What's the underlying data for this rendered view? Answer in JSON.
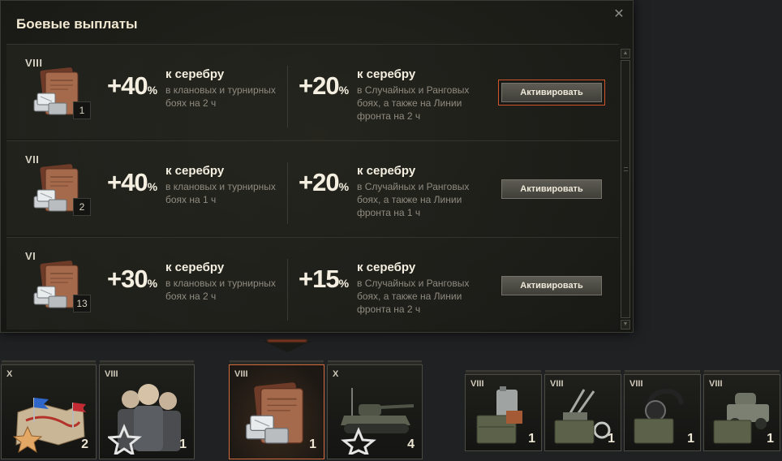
{
  "popup": {
    "title": "Боевые выплаты",
    "close_glyph": "✕",
    "rows": [
      {
        "tier": "VIII",
        "count": "1",
        "bonus1": {
          "value": "+40",
          "unit": "%",
          "head": "к серебру",
          "desc": "в клановых и турнирных боях на 2 ч"
        },
        "bonus2": {
          "value": "+20",
          "unit": "%",
          "head": "к серебру",
          "desc": "в Случайных и Ранговых боях, а также на Линии фронта на 2 ч"
        },
        "button": "Активировать",
        "focused": true
      },
      {
        "tier": "VII",
        "count": "2",
        "bonus1": {
          "value": "+40",
          "unit": "%",
          "head": "к серебру",
          "desc": "в клановых и турнирных боях на 1 ч"
        },
        "bonus2": {
          "value": "+20",
          "unit": "%",
          "head": "к серебру",
          "desc": "в Случайных и Ранговых боях, а также на Линии фронта на 1 ч"
        },
        "button": "Активировать",
        "focused": false
      },
      {
        "tier": "VI",
        "count": "13",
        "bonus1": {
          "value": "+30",
          "unit": "%",
          "head": "к серебру",
          "desc": "в клановых и турнирных боях на 2 ч"
        },
        "bonus2": {
          "value": "+15",
          "unit": "%",
          "head": "к серебру",
          "desc": "в Случайных и Ранговых боях, а также на Линии фронта на 2 ч"
        },
        "button": "Активировать",
        "focused": false
      }
    ]
  },
  "cards": [
    {
      "tier": "X",
      "count": "2",
      "icon": "battle-map-icon"
    },
    {
      "tier": "VIII",
      "count": "1",
      "icon": "soldiers-icon"
    },
    {
      "tier": "VIII",
      "count": "1",
      "icon": "battle-payments-book-icon",
      "selected": true
    },
    {
      "tier": "X",
      "count": "4",
      "icon": "tank-icon"
    },
    {
      "tier": "VIII",
      "count": "1",
      "icon": "fuel-canister-icon"
    },
    {
      "tier": "VIII",
      "count": "1",
      "icon": "anti-aircraft-gun-icon"
    },
    {
      "tier": "VIII",
      "count": "1",
      "icon": "field-radio-icon"
    },
    {
      "tier": "VIII",
      "count": "1",
      "icon": "armored-car-icon"
    }
  ],
  "colors": {
    "accent": "#d0552a",
    "text": "#f4efe0",
    "muted": "#8f8b80"
  }
}
